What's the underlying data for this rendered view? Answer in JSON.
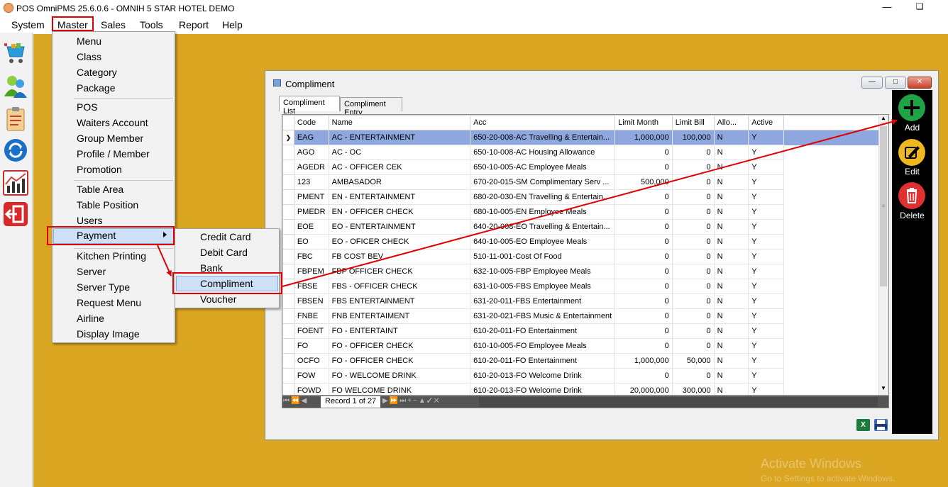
{
  "app": {
    "title": "POS OmniPMS 25.6.0.6 - OMNIH 5 STAR HOTEL DEMO"
  },
  "menubar": [
    "System",
    "Master",
    "Sales",
    "Tools",
    "Report",
    "Help"
  ],
  "master_menu": {
    "group1": [
      "Menu",
      "Class",
      "Category",
      "Package"
    ],
    "group2": [
      "POS",
      "Waiters Account",
      "Group Member",
      "Profile / Member",
      "Promotion"
    ],
    "group3": [
      "Table Area",
      "Table Position",
      "Users"
    ],
    "payment": "Payment",
    "group4": [
      "Kitchen Printing",
      "Server",
      "Server Type",
      "Request Menu",
      "Airline",
      "Display Image"
    ]
  },
  "payment_submenu": [
    "Credit Card",
    "Debit Card",
    "Bank",
    "Compliment",
    "Voucher"
  ],
  "compliment_window": {
    "title": "Compliment",
    "tabs": [
      "Compliment List",
      "Compliment Entry"
    ],
    "columns": [
      "Code",
      "Name",
      "Acc",
      "Limit Month",
      "Limit Bill",
      "Allo...",
      "Active"
    ],
    "rows": [
      [
        "EAG",
        "AC - ENTERTAINMENT",
        "650-20-008-AC Travelling & Entertain...",
        "1,000,000",
        "100,000",
        "N",
        "Y"
      ],
      [
        "AGO",
        "AC - OC",
        "650-10-008-AC Housing Allowance",
        "0",
        "0",
        "N",
        "Y"
      ],
      [
        "AGEDR",
        "AC - OFFICER CEK",
        "650-10-005-AC Employee Meals",
        "0",
        "0",
        "N",
        "Y"
      ],
      [
        "123",
        "AMBASADOR",
        "670-20-015-SM Complimentary Serv ...",
        "500,000",
        "0",
        "N",
        "Y"
      ],
      [
        "PMENT",
        "EN - ENTERTAINMENT",
        "680-20-030-EN Travelling & Entertain...",
        "0",
        "0",
        "N",
        "Y"
      ],
      [
        "PMEDR",
        "EN - OFFICER CHECK",
        "680-10-005-EN Employee Meals",
        "0",
        "0",
        "N",
        "Y"
      ],
      [
        "EOE",
        "EO - ENTERTAINMENT",
        "640-20-008-EO Travelling & Entertain...",
        "0",
        "0",
        "N",
        "Y"
      ],
      [
        "EO",
        "EO - OFICER CHECK",
        "640-10-005-EO Employee Meals",
        "0",
        "0",
        "N",
        "Y"
      ],
      [
        "FBC",
        "FB COST BEV",
        "510-11-001-Cost Of Food",
        "0",
        "0",
        "N",
        "Y"
      ],
      [
        "FBPEM",
        "FBP OFFICER CHECK",
        "632-10-005-FBP Employee Meals",
        "0",
        "0",
        "N",
        "Y"
      ],
      [
        "FBSE",
        "FBS - OFFICER CHECK",
        "631-10-005-FBS Employee Meals",
        "0",
        "0",
        "N",
        "Y"
      ],
      [
        "FBSEN",
        "FBS ENTERTAINMENT",
        "631-20-011-FBS Entertainment",
        "0",
        "0",
        "N",
        "Y"
      ],
      [
        "FNBE",
        "FNB ENTERTAIMENT",
        "631-20-021-FBS Music & Entertainment",
        "0",
        "0",
        "N",
        "Y"
      ],
      [
        "FOENT",
        "FO - ENTERTAINT",
        "610-20-011-FO Entertainment",
        "0",
        "0",
        "N",
        "Y"
      ],
      [
        "FO",
        "FO - OFFICER CHECK",
        "610-10-005-FO Employee Meals",
        "0",
        "0",
        "N",
        "Y"
      ],
      [
        "OCFO",
        "FO - OFFICER CHECK",
        "610-20-011-FO Entertainment",
        "1,000,000",
        "50,000",
        "N",
        "Y"
      ],
      [
        "FOW",
        "FO - WELCOME DRINK",
        "610-20-013-FO Welcome Drink",
        "0",
        "0",
        "N",
        "Y"
      ],
      [
        "FOWD",
        "FO WELCOME DRINK",
        "610-20-013-FO Welcome Drink",
        "20,000,000",
        "300,000",
        "N",
        "Y"
      ]
    ],
    "record_text": "Record 1 of 27",
    "excel_label": "X"
  },
  "actions": {
    "add": "Add",
    "edit": "Edit",
    "delete": "Delete"
  },
  "watermark": {
    "line1": "Activate Windows",
    "line2": "Go to Settings to activate Windows."
  },
  "colors": {
    "desktop": "#daa520",
    "highlight_red": "#e00000",
    "selected_row": "#8ea8df",
    "add_green": "#1ea345",
    "edit_yellow": "#f0b820",
    "delete_red": "#e03030"
  }
}
